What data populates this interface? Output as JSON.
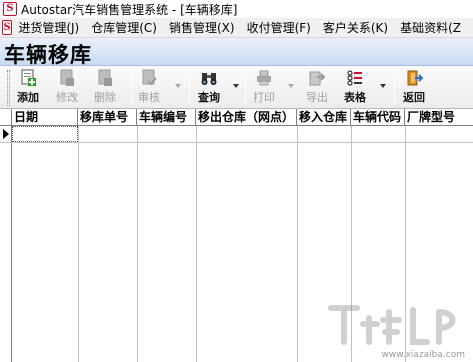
{
  "window": {
    "title": "Autostar汽车销售管理系统 - [车辆移库]",
    "logo_letter": "S"
  },
  "menubar": {
    "logo_letter": "S",
    "items": [
      {
        "label": "进货管理(J)"
      },
      {
        "label": "仓库管理(C)"
      },
      {
        "label": "销售管理(X)"
      },
      {
        "label": "收付管理(F)"
      },
      {
        "label": "客户关系(K)"
      },
      {
        "label": "基础资料(Z"
      }
    ]
  },
  "page": {
    "title": "车辆移库"
  },
  "toolbar": {
    "add_label": "添加",
    "edit_label": "修改",
    "delete_label": "删除",
    "audit_label": "审核",
    "query_label": "查询",
    "print_label": "打印",
    "export_label": "导出",
    "table_label": "表格",
    "back_label": "返回",
    "icons": {
      "add": "add-document-icon",
      "edit": "edit-document-icon",
      "delete": "delete-document-icon",
      "audit": "audit-document-icon",
      "query": "binoculars-icon",
      "print": "printer-icon",
      "export": "export-icon",
      "table": "table-columns-icon",
      "back": "exit-door-icon"
    },
    "disabled": [
      "edit",
      "delete",
      "audit",
      "print",
      "export"
    ]
  },
  "grid": {
    "columns": [
      "日期",
      "移库单号",
      "车辆编号",
      "移出仓库（网点）",
      "移入仓库",
      "车辆代码",
      "厂牌型号"
    ],
    "rows": []
  },
  "watermark": {
    "text": "www.xiazaiba.com"
  },
  "colors": {
    "brand_red": "#c8102e",
    "header_gradient_top": "#e9f1fb",
    "header_gradient_bottom": "#c9dbf1"
  }
}
